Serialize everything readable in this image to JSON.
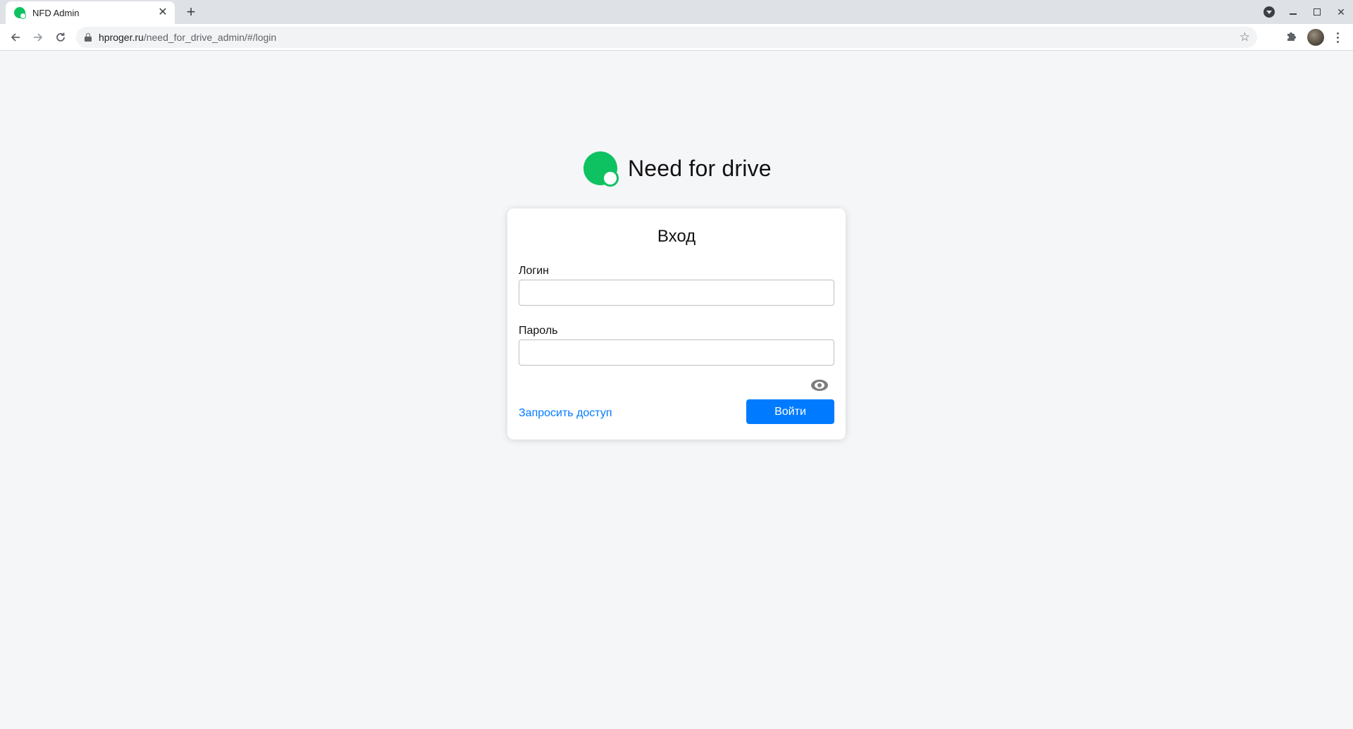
{
  "browser": {
    "tab_title": "NFD Admin",
    "tab_close": "✕",
    "new_tab": "+",
    "url_host": "hproger.ru",
    "url_path": "/need_for_drive_admin/#/login",
    "icons": [
      "back-arrow-icon",
      "forward-arrow-icon",
      "reload-icon",
      "lock-icon",
      "bookmark-star-icon",
      "extensions-puzzle-icon",
      "kebab-menu-icon"
    ]
  },
  "brand": {
    "name": "Need for drive",
    "logo_color": "#0ec261"
  },
  "login_form": {
    "title": "Вход",
    "login_label": "Логин",
    "login_value": "",
    "password_label": "Пароль",
    "password_value": "",
    "request_access_link": "Запросить доступ",
    "submit_label": "Войти"
  },
  "colors": {
    "accent": "#007bff",
    "background": "#f5f6f8",
    "card": "#ffffff"
  }
}
